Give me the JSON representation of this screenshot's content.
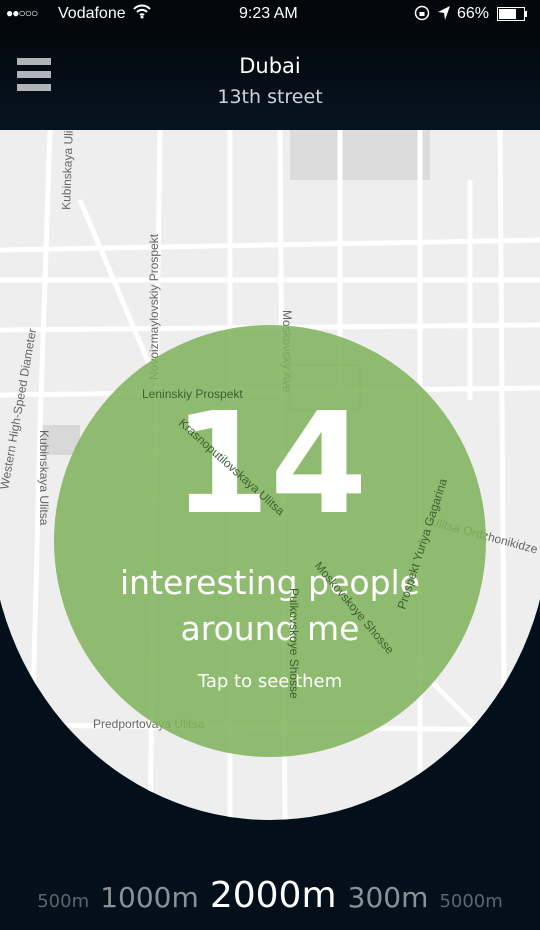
{
  "status_bar": {
    "carrier": "Vodafone",
    "time": "9:23 AM",
    "battery": "66%",
    "signal_bars": 2,
    "icons": [
      "wifi-icon",
      "rotation-lock-icon",
      "location-arrow-icon",
      "battery-icon"
    ]
  },
  "header": {
    "title": "Dubai",
    "subtitle": "13th street",
    "menu_icon": "hamburger-icon"
  },
  "map": {
    "labels": [
      "Kubinskaya Ulitsa",
      "Novoizmaylovskiy Prospekt",
      "Moskovsky Ave",
      "Western High-Speed Diameter",
      "Leninskiy Prospekt",
      "Krasnoputilovskaya Ulitsa",
      "Ulitsa Ordzhonikidze",
      "Prospekt Yuriya Gagarina",
      "Moskovskoye Shosse",
      "Pulkovskoye Shosse",
      "Predportovaya Ulitsa",
      "Kubinskaya Ulitsa"
    ]
  },
  "summary": {
    "count": "14",
    "line1": "interesting people",
    "line2": "around me",
    "cta": "Tap to see them",
    "color": "#8cb86c"
  },
  "distances": [
    {
      "label": "500m",
      "selected": false
    },
    {
      "label": "1000m",
      "selected": false
    },
    {
      "label": "2000m",
      "selected": true
    },
    {
      "label": "300m",
      "selected": false
    },
    {
      "label": "5000m",
      "selected": false
    }
  ]
}
